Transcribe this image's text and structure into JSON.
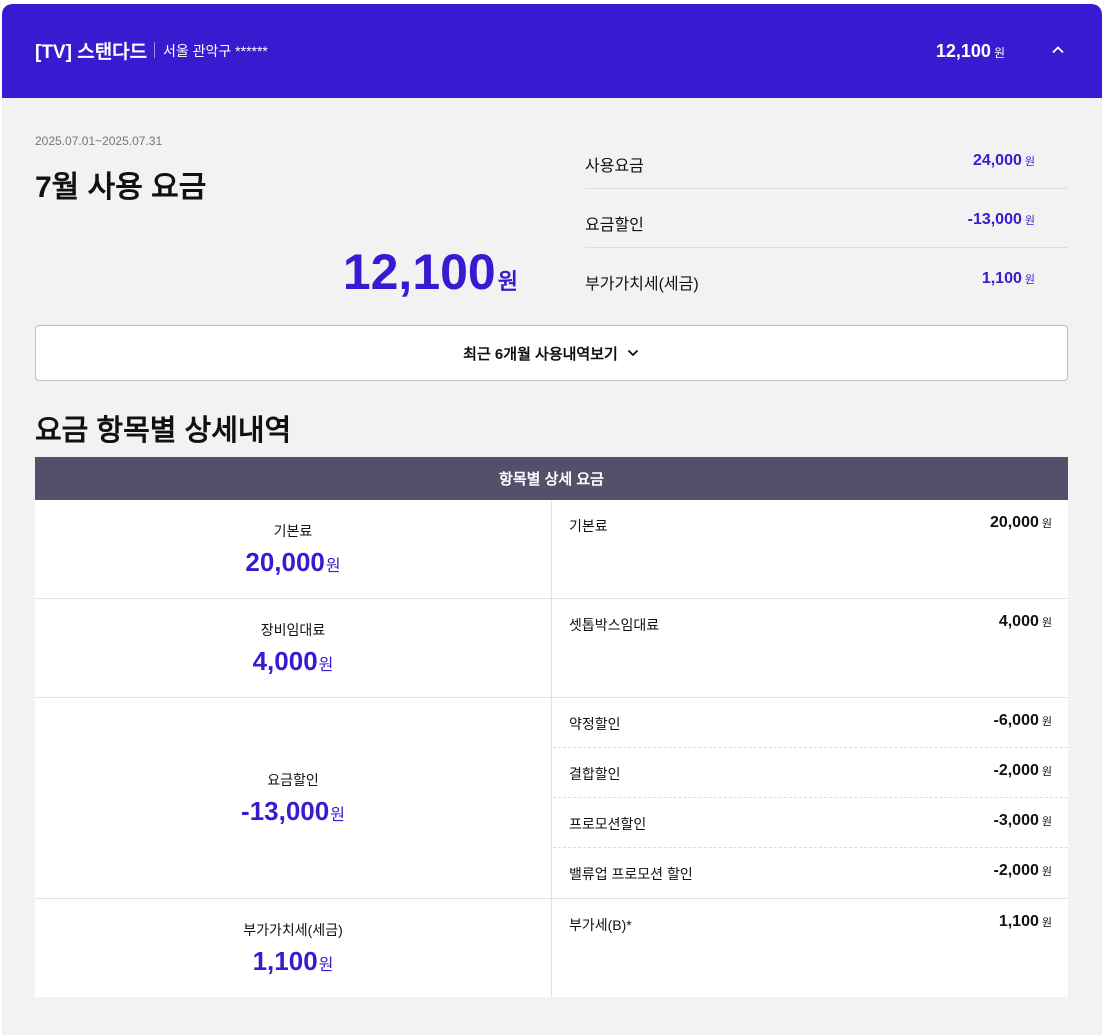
{
  "header": {
    "plan_name": "[TV] 스탠다드",
    "location": "서울 관악구 ******",
    "total_amount": "12,100",
    "won": "원"
  },
  "summary": {
    "period": "2025.07.01~2025.07.31",
    "title": "7월 사용 요금",
    "amount": "12,100",
    "won": "원",
    "rows": [
      {
        "label": "사용요금",
        "value": "24,000",
        "won": "원"
      },
      {
        "label": "요금할인",
        "value": "-13,000",
        "won": "원"
      },
      {
        "label": "부가가치세(세금)",
        "value": "1,100",
        "won": "원"
      }
    ]
  },
  "history_button": {
    "label": "최근 6개월 사용내역보기"
  },
  "detail": {
    "title": "요금 항목별 상세내역",
    "table_header": "항목별 상세 요금",
    "groups": [
      {
        "category": "기본료",
        "amount": "20,000",
        "won": "원",
        "items": [
          {
            "name": "기본료",
            "value": "20,000",
            "won": "원"
          }
        ]
      },
      {
        "category": "장비임대료",
        "amount": "4,000",
        "won": "원",
        "items": [
          {
            "name": "셋톱박스임대료",
            "value": "4,000",
            "won": "원"
          }
        ]
      },
      {
        "category": "요금할인",
        "amount": "-13,000",
        "won": "원",
        "items": [
          {
            "name": "약정할인",
            "value": "-6,000",
            "won": "원"
          },
          {
            "name": "결합할인",
            "value": "-2,000",
            "won": "원"
          },
          {
            "name": "프로모션할인",
            "value": "-3,000",
            "won": "원"
          },
          {
            "name": "밸류업 프로모션 할인",
            "value": "-2,000",
            "won": "원"
          }
        ]
      },
      {
        "category": "부가가치세(세금)",
        "amount": "1,100",
        "won": "원",
        "items": [
          {
            "name": "부가세(B)*",
            "value": "1,100",
            "won": "원"
          }
        ]
      }
    ]
  },
  "colors": {
    "accent": "#3a1ad0",
    "table_header": "#52506a",
    "panel_bg": "#f2f2f2"
  }
}
